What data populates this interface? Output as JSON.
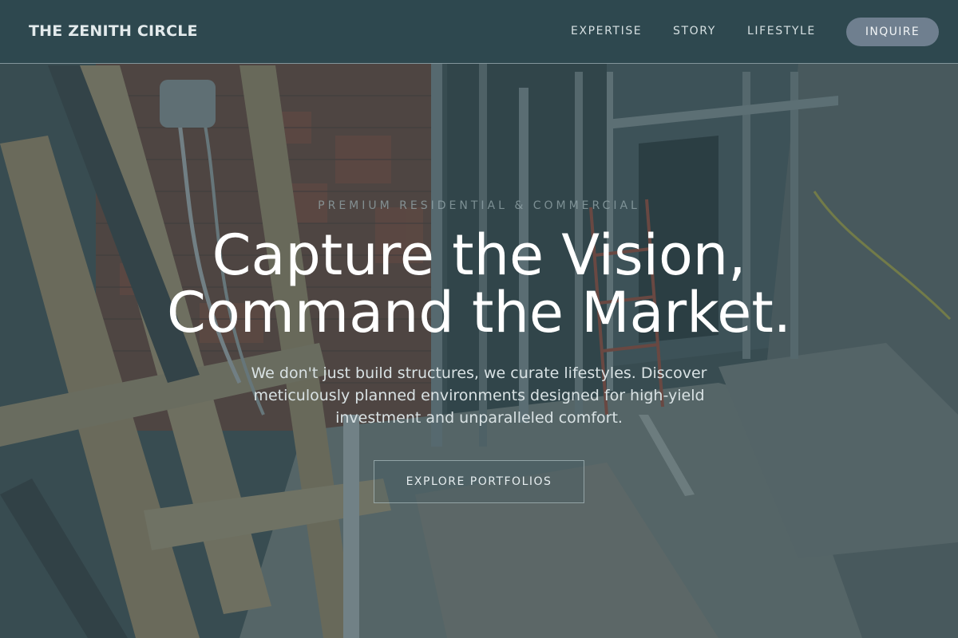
{
  "header": {
    "brand": "THE ZENITH CIRCLE",
    "nav": [
      "EXPERTISE",
      "STORY",
      "LIFESTYLE"
    ],
    "cta_label": "INQUIRE"
  },
  "hero": {
    "eyebrow": "PREMIUM RESIDENTIAL & COMMERCIAL",
    "headline_line1": "Capture the Vision,",
    "headline_line2": "Command the Market.",
    "lead": "We don't just build structures, we curate lifestyles. Discover meticulously planned environments designed for high-yield investment and unparalleled comfort.",
    "cta_label": "EXPLORE PORTFOLIOS"
  },
  "colors": {
    "header_bg": "#2c484e",
    "accent_button": "#6f7f8f",
    "overlay": "#2a4248"
  }
}
